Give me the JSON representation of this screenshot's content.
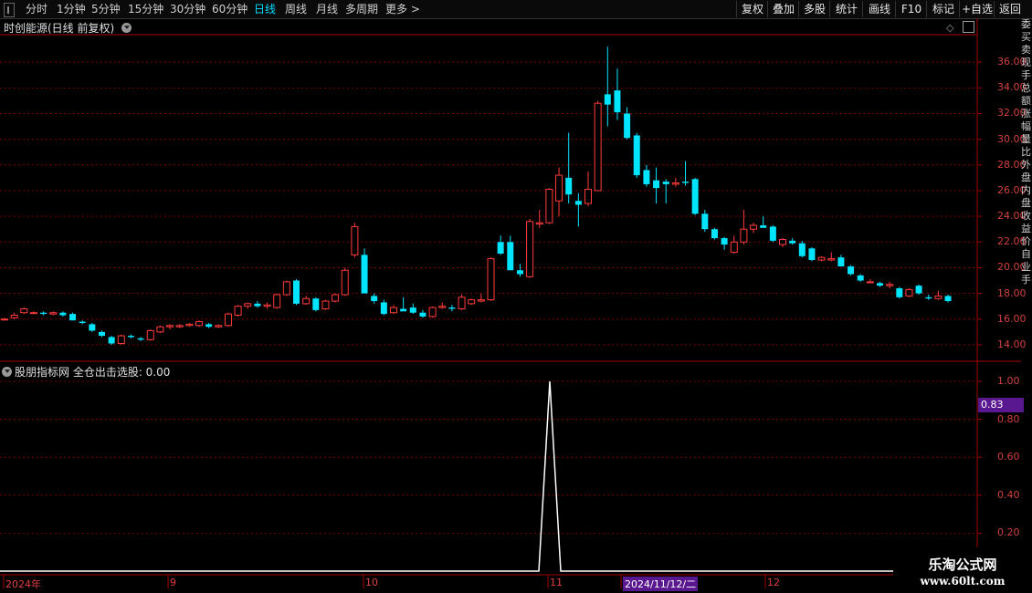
{
  "toolbar": {
    "periods": [
      "分时",
      "1分钟",
      "5分钟",
      "15分钟",
      "30分钟",
      "60分钟",
      "日线",
      "周线",
      "月线",
      "多周期",
      "更多 >"
    ],
    "active_period": "日线",
    "right_buttons": [
      "复权",
      "叠加",
      "多股",
      "统计",
      "画线",
      "F10",
      "标记",
      "+自选",
      "返回"
    ]
  },
  "main_panel": {
    "title": "时创能源(日线 前复权)",
    "price_labels": [
      "36.00",
      "34.00",
      "32.00",
      "30.00",
      "28.00",
      "26.00",
      "24.00",
      "22.00",
      "20.00",
      "18.00",
      "16.00",
      "14.00"
    ]
  },
  "indicator_panel": {
    "title": "股朋指标网 全仓出击选股: 0.00",
    "axis_labels": [
      "1.00",
      "0.80",
      "0.60",
      "0.40",
      "0.20"
    ],
    "current_value_badge": "0.83",
    "spike_value": 1.0
  },
  "date_axis": {
    "labels": [
      "2024年",
      "9",
      "10",
      "11",
      "2024/11/12/二",
      "12"
    ]
  },
  "side_strip_text": "委买卖现手总额涨幅量比外盘内盘收益价自业手",
  "watermark": {
    "line1": "乐淘公式网",
    "line2": "www.60lt.com"
  },
  "colors": {
    "up": "#ff3b3b",
    "down": "#00e5ff",
    "grid": "#7a0000",
    "axis": "#a00000",
    "highlight": "#5a1890"
  },
  "chart_data": {
    "type": "candlestick",
    "ylim": [
      13,
      38
    ],
    "candles": [
      [
        16.0,
        16.1,
        15.9,
        16.0
      ],
      [
        16.1,
        16.5,
        16.0,
        16.3
      ],
      [
        16.5,
        16.9,
        16.4,
        16.8
      ],
      [
        16.5,
        16.6,
        16.4,
        16.5
      ],
      [
        16.5,
        16.6,
        16.3,
        16.4
      ],
      [
        16.4,
        16.6,
        16.3,
        16.5
      ],
      [
        16.5,
        16.6,
        16.2,
        16.3
      ],
      [
        16.4,
        16.5,
        15.9,
        15.9
      ],
      [
        15.8,
        15.9,
        15.6,
        15.7
      ],
      [
        15.6,
        15.7,
        15.0,
        15.1
      ],
      [
        15.0,
        15.1,
        14.6,
        14.7
      ],
      [
        14.6,
        14.7,
        14.0,
        14.1
      ],
      [
        14.1,
        14.8,
        14.0,
        14.7
      ],
      [
        14.7,
        14.8,
        14.5,
        14.6
      ],
      [
        14.5,
        14.6,
        14.3,
        14.4
      ],
      [
        14.4,
        15.2,
        14.3,
        15.1
      ],
      [
        15.0,
        15.5,
        14.9,
        15.4
      ],
      [
        15.4,
        15.6,
        15.2,
        15.5
      ],
      [
        15.4,
        15.6,
        15.3,
        15.5
      ],
      [
        15.5,
        15.7,
        15.4,
        15.6
      ],
      [
        15.5,
        15.9,
        15.4,
        15.8
      ],
      [
        15.6,
        15.7,
        15.3,
        15.4
      ],
      [
        15.4,
        15.6,
        15.3,
        15.5
      ],
      [
        15.5,
        16.5,
        15.4,
        16.4
      ],
      [
        16.3,
        17.1,
        16.2,
        17.0
      ],
      [
        17.0,
        17.3,
        16.8,
        17.2
      ],
      [
        17.2,
        17.4,
        16.9,
        17.0
      ],
      [
        17.0,
        17.3,
        16.8,
        17.1
      ],
      [
        16.9,
        18.0,
        16.8,
        17.9
      ],
      [
        17.9,
        19.0,
        17.8,
        18.9
      ],
      [
        19.0,
        19.1,
        17.1,
        17.2
      ],
      [
        17.2,
        17.8,
        17.1,
        17.6
      ],
      [
        17.6,
        17.7,
        16.6,
        16.7
      ],
      [
        16.8,
        17.5,
        16.7,
        17.4
      ],
      [
        17.4,
        18.0,
        17.3,
        17.9
      ],
      [
        17.9,
        20.0,
        17.8,
        19.8
      ],
      [
        21.0,
        23.5,
        20.8,
        23.2
      ],
      [
        21.0,
        21.5,
        18.5,
        18.0
      ],
      [
        17.8,
        18.0,
        17.2,
        17.4
      ],
      [
        17.3,
        17.5,
        16.3,
        16.4
      ],
      [
        16.5,
        17.1,
        16.4,
        16.9
      ],
      [
        16.8,
        17.7,
        16.7,
        16.6
      ],
      [
        16.9,
        17.2,
        16.4,
        16.5
      ],
      [
        16.5,
        16.7,
        16.1,
        16.2
      ],
      [
        16.2,
        17.0,
        16.1,
        16.9
      ],
      [
        16.9,
        17.3,
        16.8,
        17.0
      ],
      [
        16.9,
        17.1,
        16.6,
        16.8
      ],
      [
        16.8,
        17.9,
        16.7,
        17.7
      ],
      [
        17.2,
        17.6,
        17.1,
        17.5
      ],
      [
        17.4,
        18.0,
        17.3,
        17.5
      ],
      [
        17.5,
        20.8,
        17.4,
        20.7
      ],
      [
        22.0,
        22.5,
        21.0,
        21.1
      ],
      [
        22.0,
        22.5,
        19.8,
        19.8
      ],
      [
        19.8,
        20.3,
        19.3,
        19.5
      ],
      [
        19.3,
        23.8,
        19.2,
        23.6
      ],
      [
        23.4,
        24.5,
        23.1,
        23.5
      ],
      [
        23.5,
        26.2,
        23.4,
        26.1
      ],
      [
        25.2,
        27.8,
        24.0,
        27.2
      ],
      [
        27.0,
        30.5,
        25.0,
        25.7
      ],
      [
        25.2,
        25.8,
        23.2,
        24.9
      ],
      [
        25.0,
        27.5,
        24.8,
        26.1
      ],
      [
        26.0,
        33.0,
        26.0,
        32.8
      ],
      [
        33.5,
        37.2,
        31.0,
        32.7
      ],
      [
        33.8,
        35.5,
        31.5,
        32.1
      ],
      [
        32.0,
        32.5,
        30.0,
        30.1
      ],
      [
        30.3,
        30.5,
        27.0,
        27.2
      ],
      [
        27.6,
        28.0,
        26.3,
        26.5
      ],
      [
        26.8,
        27.8,
        25.0,
        26.2
      ],
      [
        26.7,
        26.9,
        25.0,
        26.5
      ],
      [
        26.5,
        27.0,
        26.3,
        26.6
      ],
      [
        26.7,
        28.3,
        26.4,
        26.6
      ],
      [
        26.9,
        27.0,
        24.1,
        24.2
      ],
      [
        24.2,
        24.5,
        22.8,
        23.0
      ],
      [
        23.0,
        23.1,
        22.2,
        22.3
      ],
      [
        22.3,
        22.4,
        21.4,
        21.8
      ],
      [
        21.2,
        22.5,
        21.1,
        22.0
      ],
      [
        22.0,
        24.5,
        21.8,
        23.0
      ],
      [
        23.0,
        23.5,
        22.7,
        23.3
      ],
      [
        23.3,
        24.0,
        23.2,
        23.1
      ],
      [
        23.2,
        23.3,
        22.0,
        22.1
      ],
      [
        21.8,
        22.3,
        21.6,
        22.2
      ],
      [
        22.1,
        22.3,
        21.8,
        21.9
      ],
      [
        21.9,
        22.1,
        20.8,
        20.9
      ],
      [
        21.5,
        21.6,
        20.5,
        20.6
      ],
      [
        20.6,
        20.9,
        20.5,
        20.8
      ],
      [
        20.6,
        21.2,
        20.5,
        20.7
      ],
      [
        20.8,
        21.0,
        20.1,
        20.1
      ],
      [
        20.1,
        20.2,
        19.4,
        19.5
      ],
      [
        19.4,
        19.5,
        18.9,
        19.0
      ],
      [
        18.9,
        19.1,
        18.8,
        18.9
      ],
      [
        18.8,
        18.9,
        18.5,
        18.6
      ],
      [
        18.6,
        18.9,
        18.4,
        18.7
      ],
      [
        18.4,
        18.5,
        17.6,
        17.7
      ],
      [
        17.8,
        18.4,
        17.7,
        18.3
      ],
      [
        18.6,
        18.7,
        17.9,
        18.0
      ],
      [
        17.7,
        17.9,
        17.5,
        17.6
      ],
      [
        17.6,
        18.2,
        17.5,
        17.8
      ],
      [
        17.8,
        17.9,
        17.3,
        17.4
      ]
    ]
  }
}
